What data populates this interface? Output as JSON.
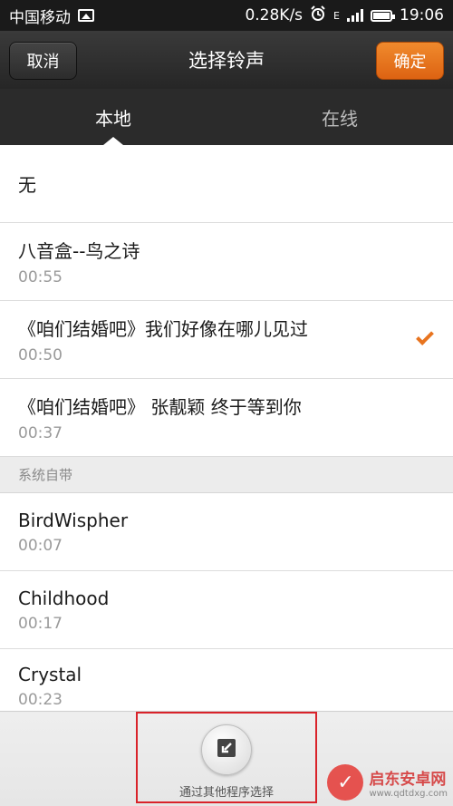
{
  "status_bar": {
    "carrier": "中国移动",
    "speed": "0.28K/s",
    "time": "19:06",
    "network": "E"
  },
  "header": {
    "cancel_label": "取消",
    "title": "选择铃声",
    "confirm_label": "确定"
  },
  "tabs": [
    {
      "label": "本地",
      "active": true
    },
    {
      "label": "在线",
      "active": false
    }
  ],
  "list": {
    "none_label": "无",
    "items": [
      {
        "name": "八音盒--鸟之诗",
        "duration": "00:55",
        "selected": false
      },
      {
        "name": "《咱们结婚吧》我们好像在哪儿见过",
        "duration": "00:50",
        "selected": true
      },
      {
        "name": "《咱们结婚吧》 张靓颖 终于等到你",
        "duration": "00:37",
        "selected": false
      }
    ],
    "system_section": "系统自带",
    "system_items": [
      {
        "name": "BirdWispher",
        "duration": "00:07"
      },
      {
        "name": "Childhood",
        "duration": "00:17"
      },
      {
        "name": "Crystal",
        "duration": "00:23"
      }
    ]
  },
  "bottom": {
    "other_app_label": "通过其他程序选择"
  },
  "watermark": {
    "title": "启东安卓网",
    "url": "www.qdtdxg.com"
  },
  "colors": {
    "accent": "#e8741f",
    "highlight_border": "#d9232a"
  }
}
